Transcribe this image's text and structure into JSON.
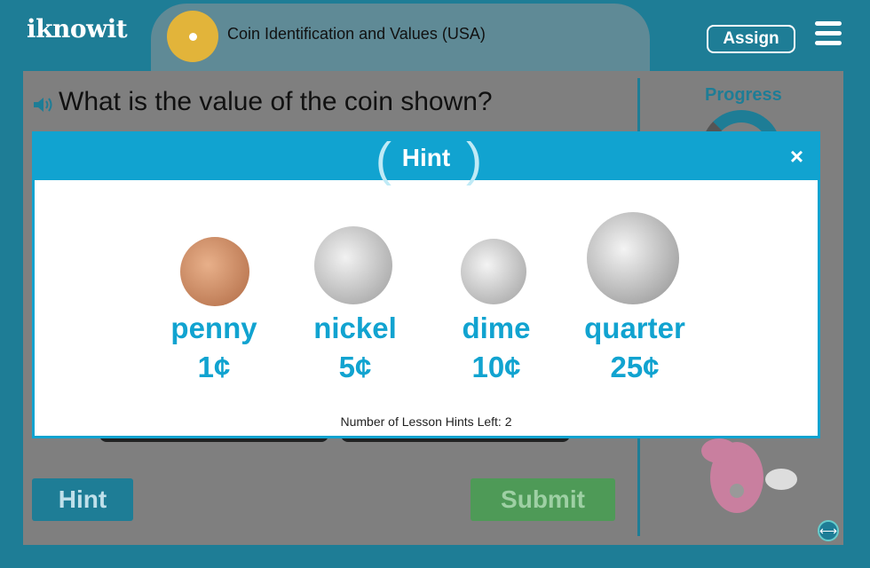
{
  "header": {
    "logo": "iknowit",
    "lesson_title": "Coin Identification and Values (USA)",
    "assign_label": "Assign"
  },
  "question": {
    "text": "What is the value of the coin shown?"
  },
  "sidebar": {
    "progress_label": "Progress"
  },
  "buttons": {
    "hint": "Hint",
    "submit": "Submit"
  },
  "modal": {
    "title": "Hint",
    "close": "×",
    "coins": [
      {
        "name": "penny",
        "value": "1¢",
        "color": "#c98a5e"
      },
      {
        "name": "nickel",
        "value": "5¢",
        "color": "#c9c9c9"
      },
      {
        "name": "dime",
        "value": "10¢",
        "color": "#cfcfcf"
      },
      {
        "name": "quarter",
        "value": "25¢",
        "color": "#bdbdbd"
      }
    ],
    "hints_left_text": "Number of Lesson Hints Left: 2"
  }
}
